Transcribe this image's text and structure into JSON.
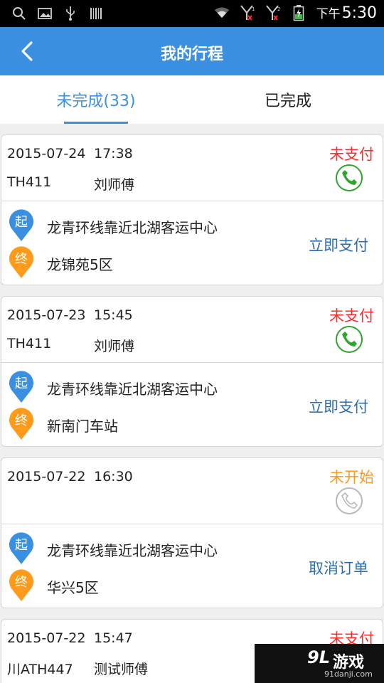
{
  "status_bar": {
    "time_prefix": "下午",
    "time": "5:30",
    "icons": [
      "search-icon",
      "image-icon",
      "usb-icon",
      "barcode-icon",
      "wifi-icon",
      "signal-1-icon",
      "signal-2-icon",
      "battery-icon"
    ]
  },
  "header": {
    "title": "我的行程",
    "back_icon": "chevron-left-icon"
  },
  "tabs": [
    {
      "label": "未完成(33)",
      "active": true
    },
    {
      "label": "已完成",
      "active": false
    }
  ],
  "trips": [
    {
      "date": "2015-07-24",
      "time": "17:38",
      "plate": "TH411",
      "driver": "刘师傅",
      "status": "未支付",
      "status_color": "#ff2a2a",
      "phone_active": true,
      "start_marker": "起",
      "end_marker": "终",
      "start": "龙青环线靠近北湖客运中心",
      "end": "龙锦苑5区",
      "action": "立即支付"
    },
    {
      "date": "2015-07-23",
      "time": "15:45",
      "plate": "TH411",
      "driver": "刘师傅",
      "status": "未支付",
      "status_color": "#ff2a2a",
      "phone_active": true,
      "start_marker": "起",
      "end_marker": "终",
      "start": "龙青环线靠近北湖客运中心",
      "end": "新南门车站",
      "action": "立即支付"
    },
    {
      "date": "2015-07-22",
      "time": "16:30",
      "plate": "",
      "driver": "",
      "status": "未开始",
      "status_color": "#ff9a1a",
      "phone_active": false,
      "start_marker": "起",
      "end_marker": "终",
      "start": "龙青环线靠近北湖客运中心",
      "end": "华兴5区",
      "action": "取消订单"
    },
    {
      "date": "2015-07-22",
      "time": "15:47",
      "plate": "川ATH447",
      "driver": "测试师傅",
      "status": "未支付",
      "status_color": "#ff2a2a"
    }
  ],
  "watermark": {
    "brand_num": "9L",
    "brand_text": "游戏",
    "url": "91danji.com"
  },
  "colors": {
    "primary": "#3a8fe0",
    "start_pin": "#3a8fe0",
    "end_pin": "#ff9a1a",
    "phone_active": "#2ea52e",
    "phone_inactive": "#b8b8b8",
    "action": "#2d6eb0"
  }
}
